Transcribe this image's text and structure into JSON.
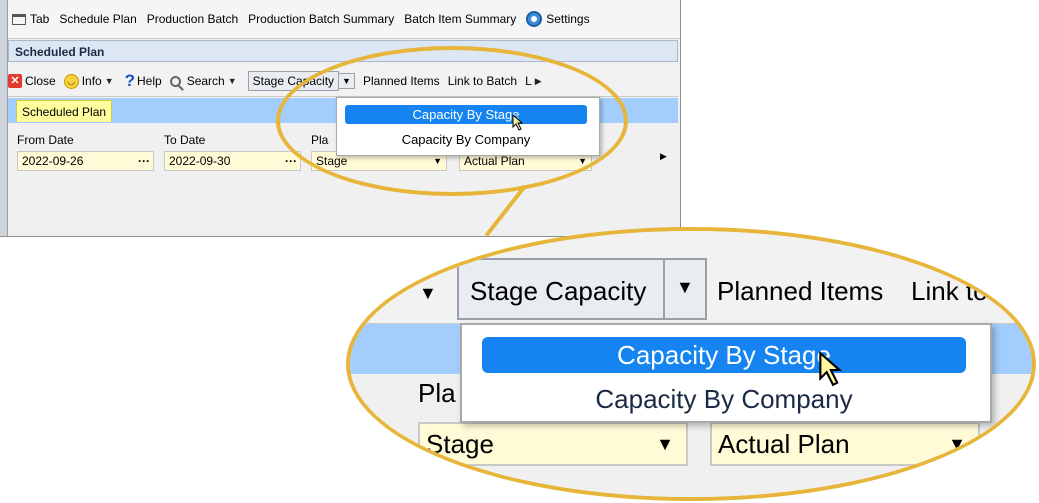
{
  "menu": {
    "items": [
      {
        "label": "Tab",
        "icon": "tab-icon"
      },
      {
        "label": "Schedule Plan"
      },
      {
        "label": "Production Batch"
      },
      {
        "label": "Production Batch Summary"
      },
      {
        "label": "Batch Item Summary"
      },
      {
        "label": "Settings",
        "icon": "gear-icon"
      }
    ]
  },
  "panel": {
    "title": "Scheduled Plan"
  },
  "toolbar": {
    "close": "Close",
    "info": "Info",
    "help": "Help",
    "search": "Search",
    "stage_capacity": "Stage Capacity",
    "planned_items": "Planned Items",
    "link_to_batch": "Link to Batch",
    "more": "L"
  },
  "tabs": {
    "active": "Scheduled Plan"
  },
  "form": {
    "from_date_label": "From Date",
    "from_date_value": "2022-09-26",
    "to_date_label": "To Date",
    "to_date_value": "2022-09-30",
    "plan_label_partial": "Pla",
    "plan_type_value": "Stage",
    "plan_kind_value": "Actual Plan"
  },
  "dropdown": {
    "items": [
      {
        "label": "Capacity By Stage",
        "selected": true
      },
      {
        "label": "Capacity By Company",
        "selected": false
      }
    ]
  },
  "zoom": {
    "stage_capacity": "Stage Capacity",
    "planned_items": "Planned Items",
    "link_to_partial": "Link to",
    "plan_label_partial": "Pla",
    "plan_type_value": "Stage",
    "plan_kind_value": "Actual Plan"
  },
  "colors": {
    "highlight": "#e6b53a",
    "selection": "#1584f0",
    "ribbon": "#a3cdfc",
    "active_tab": "#fffd9e",
    "field_bg": "#fffbd6"
  }
}
